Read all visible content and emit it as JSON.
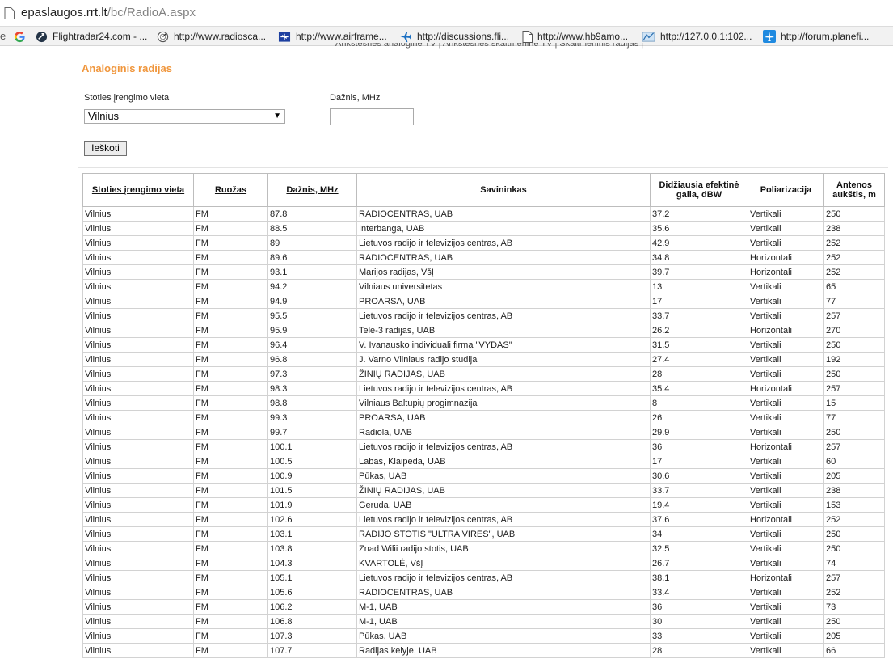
{
  "browser": {
    "url_host": "epaslaugos.rrt.lt",
    "url_path": "/bc/RadioA.aspx",
    "bookmarks_edge": "e",
    "bookmarks": [
      {
        "label": "",
        "icon": "google-icon"
      },
      {
        "label": "Flightradar24.com - ...",
        "icon": "flightradar-icon"
      },
      {
        "label": "http://www.radiosca...",
        "icon": "radar-icon"
      },
      {
        "label": "http://www.airframe...",
        "icon": "airframe-icon"
      },
      {
        "label": "http://discussions.fli...",
        "icon": "plane-icon"
      },
      {
        "label": "http://www.hb9amo...",
        "icon": "page-icon"
      },
      {
        "label": "http://127.0.0.1:102...",
        "icon": "map-icon"
      },
      {
        "label": "http://forum.planefi...",
        "icon": "planefinder-icon"
      }
    ]
  },
  "page": {
    "cut_nav_text": "Ankstesnės analoginė TV | Ankstesnės skaitmeninė TV | Skaitmeninis radijas |",
    "section_title": "Analoginis radijas",
    "form": {
      "location_label": "Stoties įrengimo vieta",
      "location_value": "Vilnius",
      "frequency_label": "Dažnis, MHz",
      "frequency_value": "",
      "search_button": "Ieškoti"
    }
  },
  "table": {
    "columns": [
      {
        "label": "Stoties įrengimo vieta",
        "sortable": true
      },
      {
        "label": "Ruožas",
        "sortable": true
      },
      {
        "label": "Dažnis, MHz",
        "sortable": true
      },
      {
        "label": "Savininkas",
        "sortable": false
      },
      {
        "label": "Didžiausia efektinė galia, dBW",
        "sortable": false
      },
      {
        "label": "Poliarizacija",
        "sortable": false
      },
      {
        "label": "Antenos aukštis, m",
        "sortable": false
      }
    ],
    "rows": [
      [
        "Vilnius",
        "FM",
        "87.8",
        "RADIOCENTRAS, UAB",
        "37.2",
        "Vertikali",
        "250"
      ],
      [
        "Vilnius",
        "FM",
        "88.5",
        "Interbanga, UAB",
        "35.6",
        "Vertikali",
        "238"
      ],
      [
        "Vilnius",
        "FM",
        "89",
        "Lietuvos radijo ir televizijos centras, AB",
        "42.9",
        "Vertikali",
        "252"
      ],
      [
        "Vilnius",
        "FM",
        "89.6",
        "RADIOCENTRAS, UAB",
        "34.8",
        "Horizontali",
        "252"
      ],
      [
        "Vilnius",
        "FM",
        "93.1",
        "Marijos radijas, VšĮ",
        "39.7",
        "Horizontali",
        "252"
      ],
      [
        "Vilnius",
        "FM",
        "94.2",
        "Vilniaus universitetas",
        "13",
        "Vertikali",
        "65"
      ],
      [
        "Vilnius",
        "FM",
        "94.9",
        "PROARSA, UAB",
        "17",
        "Vertikali",
        "77"
      ],
      [
        "Vilnius",
        "FM",
        "95.5",
        "Lietuvos radijo ir televizijos centras, AB",
        "33.7",
        "Vertikali",
        "257"
      ],
      [
        "Vilnius",
        "FM",
        "95.9",
        "Tele-3 radijas, UAB",
        "26.2",
        "Horizontali",
        "270"
      ],
      [
        "Vilnius",
        "FM",
        "96.4",
        "V. Ivanausko individuali firma \"VYDAS\"",
        "31.5",
        "Vertikali",
        "250"
      ],
      [
        "Vilnius",
        "FM",
        "96.8",
        "J. Varno Vilniaus radijo studija",
        "27.4",
        "Vertikali",
        "192"
      ],
      [
        "Vilnius",
        "FM",
        "97.3",
        "ŽINIŲ RADIJAS, UAB",
        "28",
        "Vertikali",
        "250"
      ],
      [
        "Vilnius",
        "FM",
        "98.3",
        "Lietuvos radijo ir televizijos centras, AB",
        "35.4",
        "Horizontali",
        "257"
      ],
      [
        "Vilnius",
        "FM",
        "98.8",
        "Vilniaus Baltupių progimnazija",
        "8",
        "Vertikali",
        "15"
      ],
      [
        "Vilnius",
        "FM",
        "99.3",
        "PROARSA, UAB",
        "26",
        "Vertikali",
        "77"
      ],
      [
        "Vilnius",
        "FM",
        "99.7",
        "Radiola, UAB",
        "29.9",
        "Vertikali",
        "250"
      ],
      [
        "Vilnius",
        "FM",
        "100.1",
        "Lietuvos radijo ir televizijos centras, AB",
        "36",
        "Horizontali",
        "257"
      ],
      [
        "Vilnius",
        "FM",
        "100.5",
        "Labas, Klaipėda, UAB",
        "17",
        "Vertikali",
        "60"
      ],
      [
        "Vilnius",
        "FM",
        "100.9",
        "Pūkas, UAB",
        "30.6",
        "Vertikali",
        "205"
      ],
      [
        "Vilnius",
        "FM",
        "101.5",
        "ŽINIŲ RADIJAS, UAB",
        "33.7",
        "Vertikali",
        "238"
      ],
      [
        "Vilnius",
        "FM",
        "101.9",
        "Geruda, UAB",
        "19.4",
        "Vertikali",
        "153"
      ],
      [
        "Vilnius",
        "FM",
        "102.6",
        "Lietuvos radijo ir televizijos centras, AB",
        "37.6",
        "Horizontali",
        "252"
      ],
      [
        "Vilnius",
        "FM",
        "103.1",
        "RADIJO STOTIS \"ULTRA VIRES\", UAB",
        "34",
        "Vertikali",
        "250"
      ],
      [
        "Vilnius",
        "FM",
        "103.8",
        "Znad Wilii radijo stotis, UAB",
        "32.5",
        "Vertikali",
        "250"
      ],
      [
        "Vilnius",
        "FM",
        "104.3",
        "KVARTOLĖ, VšĮ",
        "26.7",
        "Vertikali",
        "74"
      ],
      [
        "Vilnius",
        "FM",
        "105.1",
        "Lietuvos radijo ir televizijos centras, AB",
        "38.1",
        "Horizontali",
        "257"
      ],
      [
        "Vilnius",
        "FM",
        "105.6",
        "RADIOCENTRAS, UAB",
        "33.4",
        "Vertikali",
        "252"
      ],
      [
        "Vilnius",
        "FM",
        "106.2",
        "M-1, UAB",
        "36",
        "Vertikali",
        "73"
      ],
      [
        "Vilnius",
        "FM",
        "106.8",
        "M-1, UAB",
        "30",
        "Vertikali",
        "250"
      ],
      [
        "Vilnius",
        "FM",
        "107.3",
        "Pūkas, UAB",
        "33",
        "Vertikali",
        "205"
      ],
      [
        "Vilnius",
        "FM",
        "107.7",
        "Radijas kelyje, UAB",
        "28",
        "Vertikali",
        "66"
      ]
    ]
  }
}
